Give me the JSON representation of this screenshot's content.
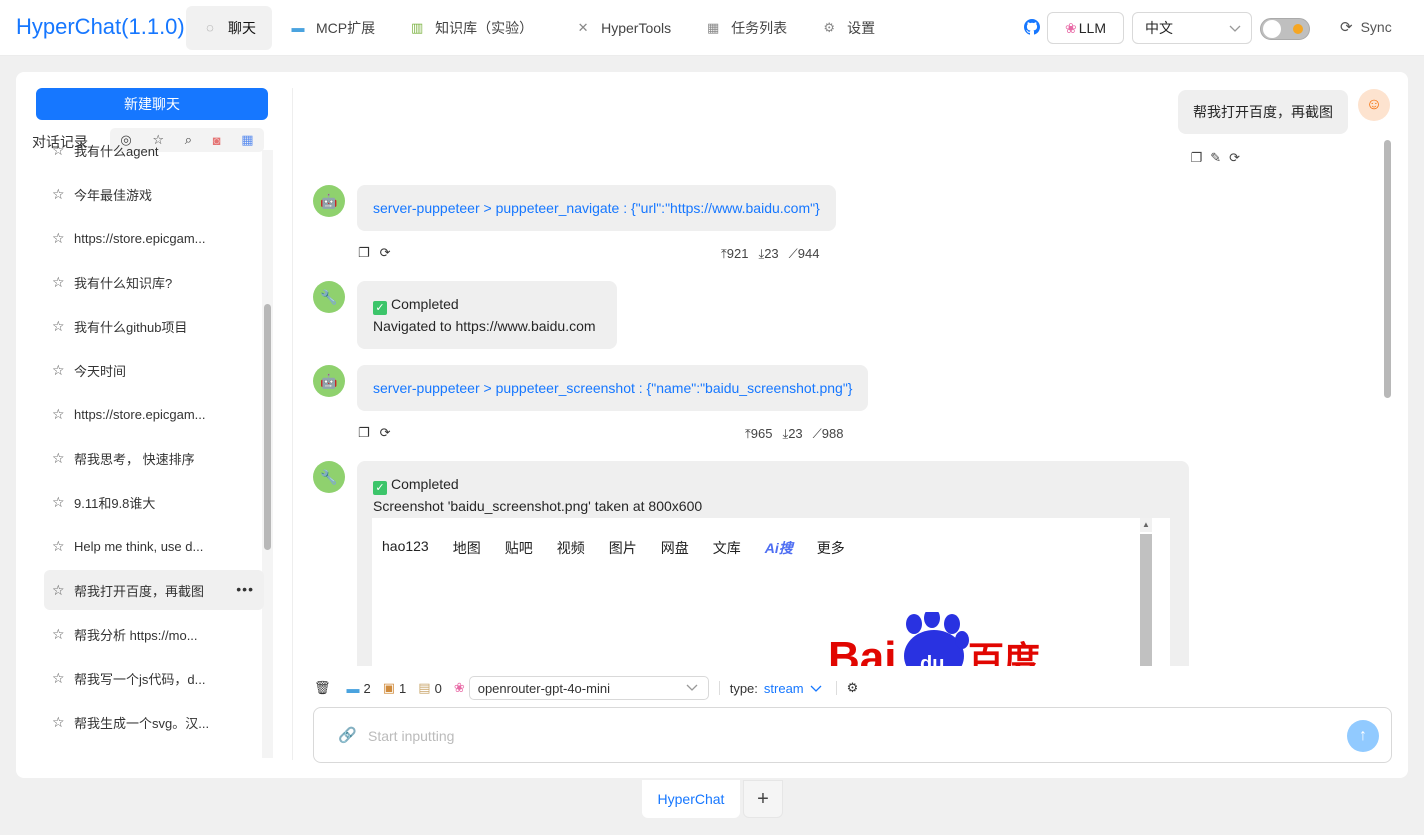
{
  "app": {
    "title": "HyperChat(1.1.0)"
  },
  "nav": [
    {
      "label": "聊天",
      "icon": "chat-bubble-icon"
    },
    {
      "label": "MCP扩展",
      "icon": "monitor-icon"
    },
    {
      "label": "知识库（实验）",
      "icon": "books-icon"
    },
    {
      "label": "HyperTools",
      "icon": "tools-icon"
    },
    {
      "label": "任务列表",
      "icon": "calendar-icon"
    },
    {
      "label": "设置",
      "icon": "gear-icon"
    }
  ],
  "header": {
    "llm_label": "LLM",
    "language": "中文",
    "sync_label": "Sync"
  },
  "sidebar": {
    "new_chat": "新建聊天",
    "history_label": "对话记录",
    "items": [
      "我有什么agent",
      "今年最佳游戏",
      "https://store.epicgam...",
      "我有什么知识库?",
      "我有什么github项目",
      "今天时间",
      "https://store.epicgam...",
      "帮我思考， 快速排序",
      "9.11和9.8谁大",
      "Help me think, use d...",
      "帮我打开百度，再截图",
      "帮我分析 https://mo...",
      "帮我写一个js代码，d...",
      "帮我生成一个svg。汉..."
    ],
    "active_index": 10
  },
  "chat": {
    "user_message": "帮我打开百度，再截图",
    "call1": "server-puppeteer > puppeteer_navigate : {\"url\":\"https://www.baidu.com\"}",
    "call1_stats": {
      "up": "921",
      "down": "23",
      "total": "944"
    },
    "result1_status": "Completed",
    "result1_text": "Navigated to https://www.baidu.com",
    "call2": "server-puppeteer > puppeteer_screenshot : {\"name\":\"baidu_screenshot.png\"}",
    "call2_stats": {
      "up": "965",
      "down": "23",
      "total": "988"
    },
    "result2_status": "Completed",
    "result2_text": "Screenshot 'baidu_screenshot.png' taken at 800x600",
    "screenshot_nav": [
      "hao123",
      "地图",
      "贴吧",
      "视频",
      "图片",
      "网盘",
      "文库",
      "Ai搜",
      "更多"
    ],
    "screenshot_logo": {
      "left": "Bai",
      "center": "du",
      "right": "百度"
    }
  },
  "composer": {
    "mcp_count": "2",
    "kb_count": "1",
    "prompt_count": "0",
    "model": "openrouter-gpt-4o-mini",
    "type_label": "type:",
    "type_value": "stream",
    "placeholder": "Start inputting"
  },
  "tabs": {
    "current": "HyperChat",
    "add": "+"
  },
  "colors": {
    "accent": "#1677ff",
    "bot_avatar": "#8fd16e",
    "baidu_red": "#e10601",
    "baidu_blue": "#2932e1"
  }
}
